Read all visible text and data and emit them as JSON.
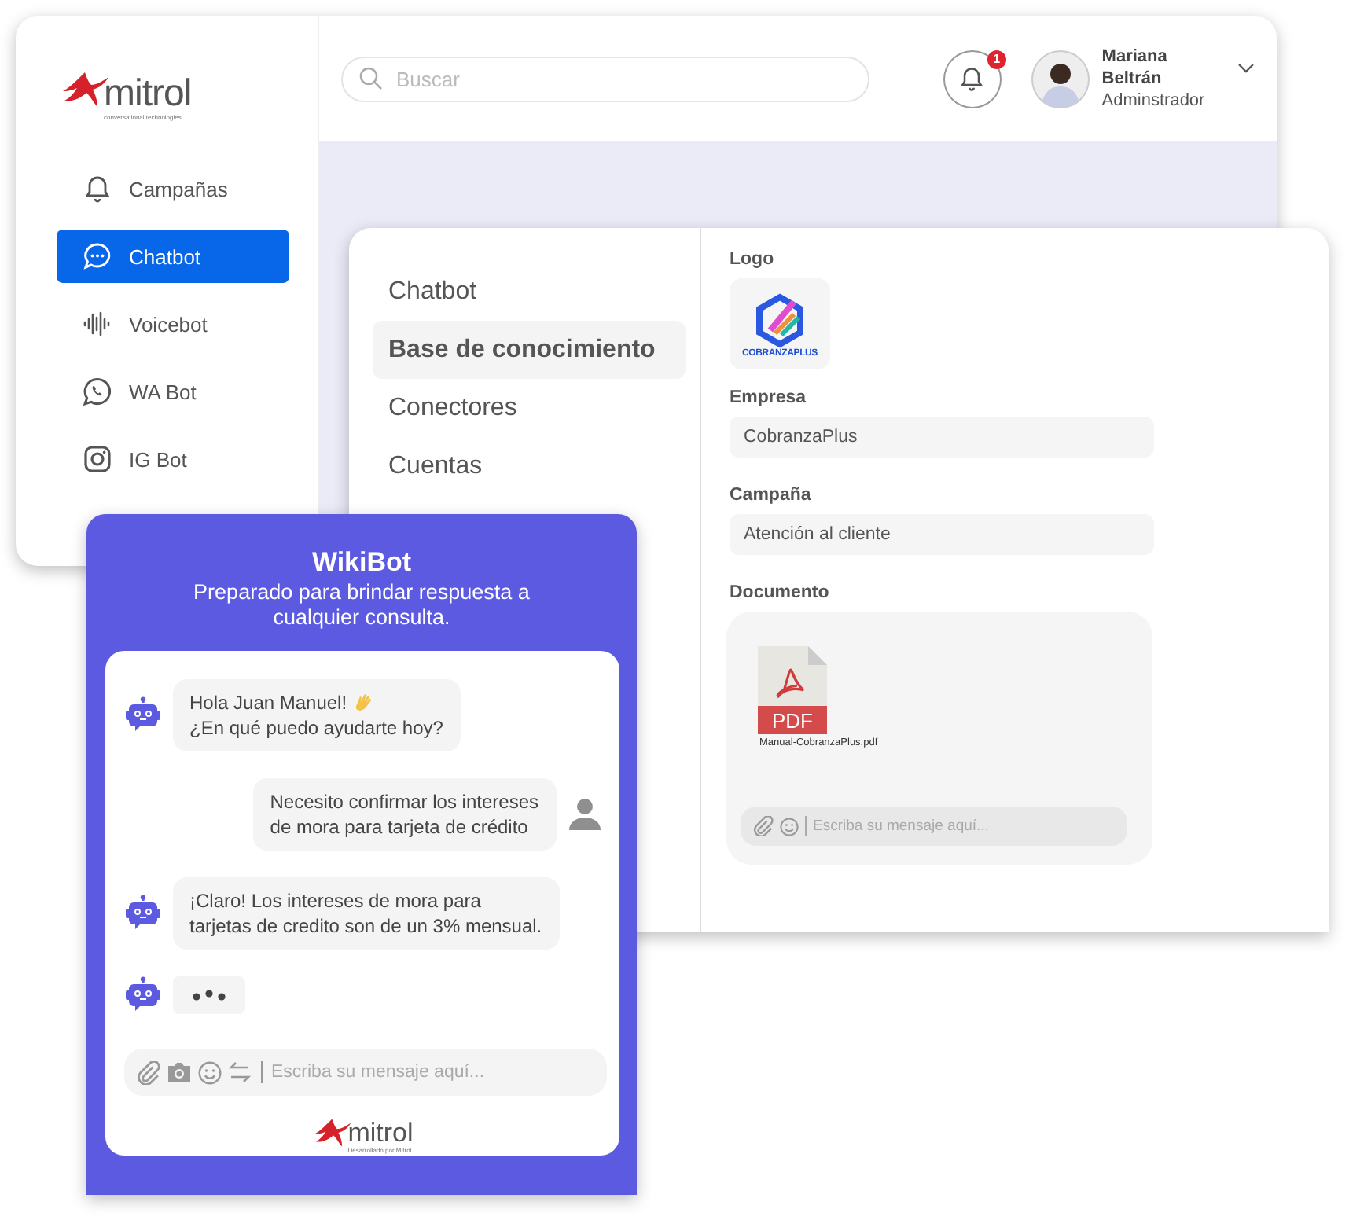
{
  "app": {
    "logo": {
      "name": "mitrol",
      "tagline": "conversational technologies"
    },
    "search": {
      "placeholder": "Buscar"
    },
    "notifications": {
      "count": "1"
    },
    "user": {
      "name": "Mariana Beltrán",
      "role": "Adminstrador"
    },
    "sidebar": {
      "items": [
        {
          "label": "Campañas",
          "kind": "bell",
          "selected": false
        },
        {
          "label": "Chatbot",
          "kind": "chat",
          "selected": true
        },
        {
          "label": "Voicebot",
          "kind": "wave",
          "selected": false
        },
        {
          "label": "WA Bot",
          "kind": "whatsapp",
          "selected": false
        },
        {
          "label": "IG Bot",
          "kind": "instagram",
          "selected": false
        }
      ]
    }
  },
  "settings": {
    "menu": [
      {
        "label": "Chatbot",
        "selected": false
      },
      {
        "label": "Base de conocimiento",
        "selected": true
      },
      {
        "label": "Conectores",
        "selected": false
      },
      {
        "label": "Cuentas",
        "selected": false
      }
    ],
    "logo": {
      "label": "Logo",
      "text": "COBRANZAPLUS"
    },
    "fields": [
      {
        "label": "Empresa",
        "value": "CobranzaPlus"
      },
      {
        "label": "Campaña",
        "value": "Atención al cliente"
      }
    ],
    "document": {
      "label": "Documento",
      "file_type": "PDF",
      "file_name": "Manual-CobranzaPlus.pdf",
      "input": {
        "placeholder": "Escriba su mensaje aquí..."
      }
    }
  },
  "chat": {
    "title": "WikiBot",
    "subtitle": "Preparado para brindar respuesta a cualquier consulta.",
    "messages": [
      {
        "kind": "bot",
        "lines": [
          "Hola Juan Manuel!",
          "¿En qué puedo ayudarte hoy?"
        ],
        "wave": true
      },
      {
        "kind": "user",
        "lines": [
          "Necesito confirmar los intereses",
          "de mora para tarjeta de crédito"
        ],
        "wave": false
      },
      {
        "kind": "bot",
        "lines": [
          "¡Claro! Los intereses de mora para",
          "tarjetas de credito son de un 3% mensual."
        ],
        "wave": false
      },
      {
        "kind": "typing"
      }
    ],
    "input": {
      "placeholder": "Escriba su mensaje aquí..."
    },
    "footer": {
      "name": "mitrol",
      "tagline": "Desarrollado por Mitrol"
    }
  }
}
